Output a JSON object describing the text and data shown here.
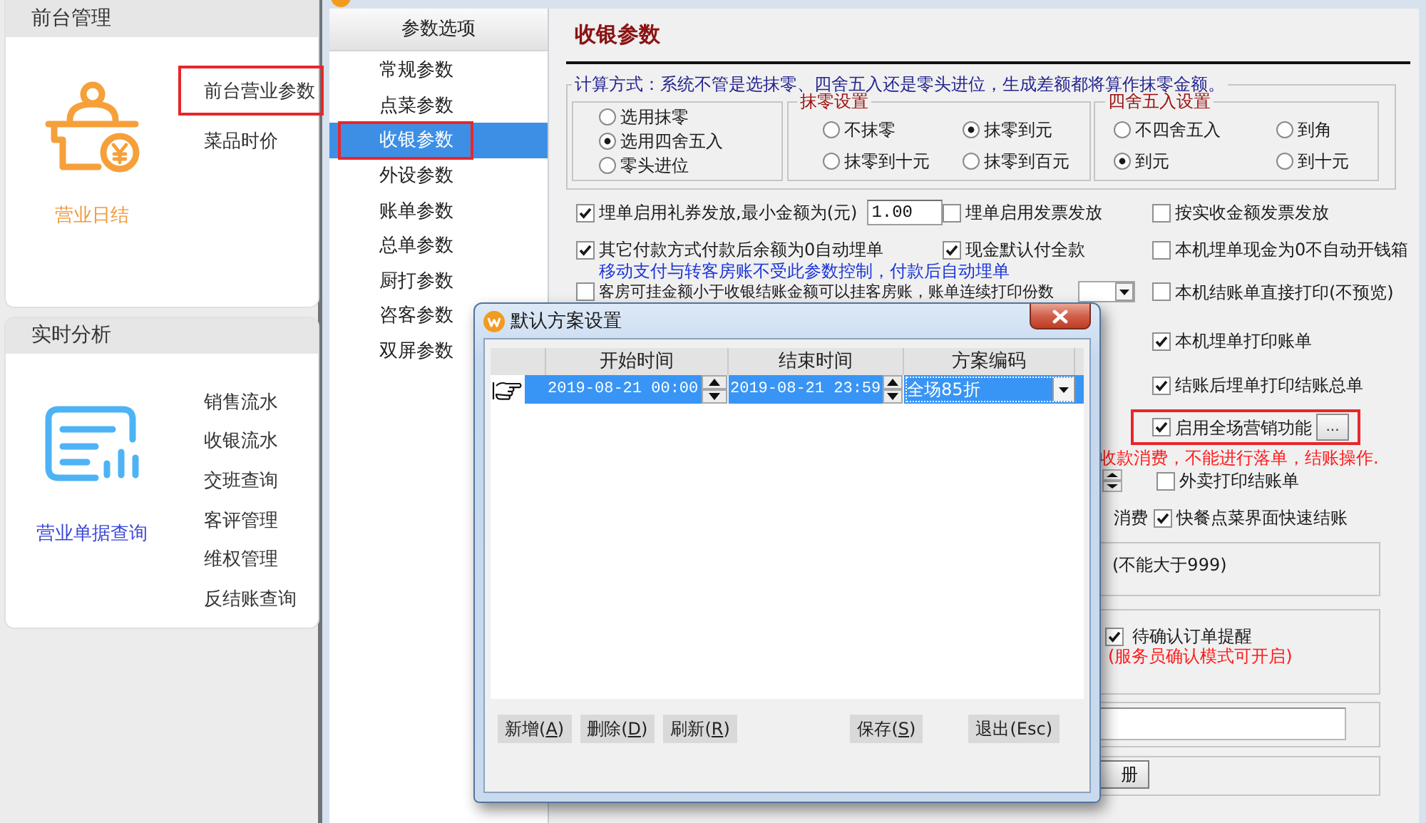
{
  "left_panel": {
    "cards": [
      {
        "title": "前台管理",
        "feature": {
          "kind": "cashier",
          "label": "营业日结"
        },
        "links": [
          {
            "label": "前台营业参数",
            "highlighted": true
          },
          {
            "label": "菜品时价",
            "highlighted": false
          }
        ]
      },
      {
        "title": "实时分析",
        "feature": {
          "kind": "report",
          "label": "营业单据查询"
        },
        "links": [
          {
            "label": "销售流水",
            "highlighted": false
          },
          {
            "label": "收银流水",
            "highlighted": false
          },
          {
            "label": "交班查询",
            "highlighted": false
          },
          {
            "label": "客评管理",
            "highlighted": false
          },
          {
            "label": "维权管理",
            "highlighted": false
          },
          {
            "label": "反结账查询",
            "highlighted": false
          }
        ]
      }
    ]
  },
  "settings_window": {
    "sidebar": {
      "header": "参数选项",
      "items": [
        {
          "label": "常规参数",
          "selected": false,
          "highlighted": false
        },
        {
          "label": "点菜参数",
          "selected": false,
          "highlighted": false
        },
        {
          "label": "收银参数",
          "selected": true,
          "highlighted": true
        },
        {
          "label": "外设参数",
          "selected": false,
          "highlighted": false
        },
        {
          "label": "账单参数",
          "selected": false,
          "highlighted": false
        },
        {
          "label": "总单参数",
          "selected": false,
          "highlighted": false
        },
        {
          "label": "厨打参数",
          "selected": false,
          "highlighted": false
        },
        {
          "label": "咨客参数",
          "selected": false,
          "highlighted": false
        },
        {
          "label": "双屏参数",
          "selected": false,
          "highlighted": false
        }
      ]
    },
    "page": {
      "title": "收银参数",
      "calculation": {
        "legend": "计算方式：系统不管是选抹零、四舍五入还是零头进位，生成差额都将算作抹零金额。",
        "groups": [
          {
            "kind": "stack",
            "options": [
              {
                "label": "选用抹零",
                "selected": false
              },
              {
                "label": "选用四舍五入",
                "selected": true
              },
              {
                "label": "零头进位",
                "selected": false
              }
            ]
          },
          {
            "kind": "grid",
            "legend": "抹零设置",
            "options": [
              {
                "label": "不抹零",
                "selected": false
              },
              {
                "label": "抹零到元",
                "selected": true
              },
              {
                "label": "抹零到十元",
                "selected": false
              },
              {
                "label": "抹零到百元",
                "selected": false
              }
            ]
          },
          {
            "kind": "grid",
            "legend": "四舍五入设置",
            "options": [
              {
                "label": "不四舍五入",
                "selected": false
              },
              {
                "label": "到角",
                "selected": false
              },
              {
                "label": "到元",
                "selected": true
              },
              {
                "label": "到十元",
                "selected": false
              }
            ]
          }
        ]
      },
      "option_rows": [
        [
          {
            "kind": "amount",
            "label": "埋单启用礼券发放,最小金额为(元)",
            "checked": true,
            "value": "1.00"
          },
          {
            "kind": "checkbox",
            "label": "埋单启用发票发放",
            "checked": false
          },
          {
            "kind": "checkbox",
            "label": "按实收金额发票发放",
            "checked": false
          }
        ],
        [
          {
            "kind": "checkbox",
            "label": "其它付款方式付款后余额为0自动埋单",
            "checked": true
          },
          {
            "kind": "checkbox",
            "label": "现金默认付全款",
            "checked": true
          },
          {
            "kind": "checkbox",
            "label": "本机埋单现金为0不自动开钱箱",
            "checked": false
          }
        ]
      ],
      "payment_note": "移动支付与转客房账不受此参数控制，付款后自动埋单",
      "room_row": {
        "room_charge": {
          "label": "客房可挂金额小于收银结账金额可以挂客房账，账单连续打印份数",
          "checked": false
        },
        "direct_print": {
          "label": "本机结账单直接打印(不预览)",
          "checked": false
        }
      },
      "right_items": [
        {
          "kind": "checkbox",
          "label": "本机埋单打印账单",
          "checked": true
        },
        {
          "kind": "checkbox",
          "label": "结账后埋单打印结账总单",
          "checked": true
        },
        {
          "kind": "checkbox_button",
          "label": "启用全场营销功能",
          "checked": true,
          "button": "...",
          "highlighted": true
        },
        {
          "kind": "warning",
          "text": "收款消费，不能进行落单，结账操作."
        },
        {
          "kind": "spinner_checkbox",
          "label": "外卖打印结账单",
          "checked": false
        },
        {
          "kind": "prefixed_checkbox",
          "prefix": "消费",
          "label": "快餐点菜界面快速结账",
          "checked": true
        },
        {
          "kind": "note_box",
          "text": "(不能大于999)"
        },
        {
          "kind": "checkbox_box",
          "label": "待确认订单提醒",
          "checked": true,
          "note": "(服务员确认模式可开启)"
        },
        {
          "kind": "input_box"
        },
        {
          "kind": "button_box",
          "button": "册"
        }
      ]
    }
  },
  "dialog": {
    "title": "默认方案设置",
    "columns": [
      "开始时间",
      "结束时间",
      "方案编码"
    ],
    "rows": [
      {
        "selected": true,
        "start_time": "2019-08-21 00:00",
        "end_time": "2019-08-21 23:59",
        "scheme_code": "全场85折"
      }
    ],
    "button_groups": [
      [
        {
          "label": "新增(A)",
          "mnemonic": true
        },
        {
          "label": "删除(D)",
          "mnemonic": true
        },
        {
          "label": "刷新(R)",
          "mnemonic": true
        }
      ],
      [
        {
          "label": "保存(S)",
          "mnemonic": true
        },
        {
          "label": "退出(Esc)",
          "mnemonic": false
        }
      ]
    ]
  }
}
